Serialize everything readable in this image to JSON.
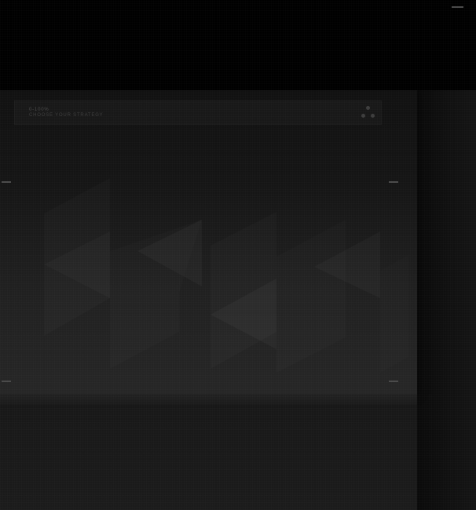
{
  "panel": {
    "range_label": "0-100%",
    "subtitle": "CHOOSE YOUR STRATEGY"
  },
  "icons": {
    "menu": "three-dots-icon",
    "artwork": "rewind-chevrons-icon"
  },
  "colors": {
    "background": "#000000",
    "panel": "#1a1a1a",
    "text": "#4a4a4a",
    "marker": "#4a4a4a"
  }
}
